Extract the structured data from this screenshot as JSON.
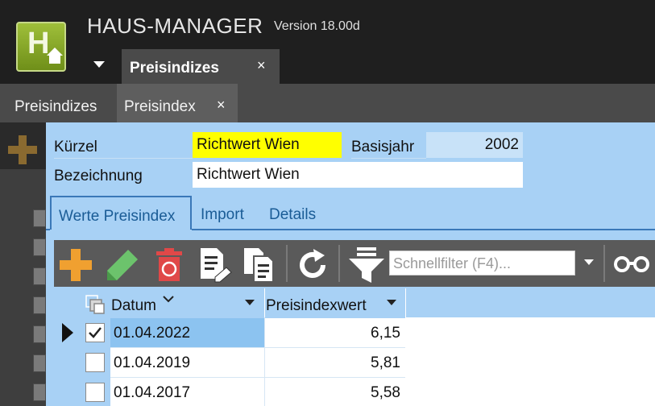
{
  "app": {
    "name": "HAUS-MANAGER",
    "version": "Version 18.00d",
    "logo_letter": "H"
  },
  "top_tabs": [
    {
      "label": "Preisindizes",
      "close": "×"
    }
  ],
  "doc_tabs": [
    {
      "label": "Preisindizes"
    },
    {
      "label": "Preisindex",
      "close": "×",
      "active": true
    }
  ],
  "form": {
    "kuerzel_label": "Kürzel",
    "kuerzel_value": "Richtwert Wien",
    "basisjahr_label": "Basisjahr",
    "basisjahr_value": "2002",
    "bezeichnung_label": "Bezeichnung",
    "bezeichnung_value": "Richtwert Wien"
  },
  "sub_tabs": [
    {
      "label": "Werte Preisindex",
      "active": true
    },
    {
      "label": "Import"
    },
    {
      "label": "Details"
    }
  ],
  "toolbar": {
    "filter_placeholder": "Schnellfilter (F4)..."
  },
  "grid": {
    "columns": [
      {
        "label": "Datum"
      },
      {
        "label": "Preisindexwert"
      }
    ],
    "rows": [
      {
        "datum": "01.04.2022",
        "wert": "6,15",
        "checked": true,
        "selected": true
      },
      {
        "datum": "01.04.2019",
        "wert": "5,81",
        "checked": false,
        "selected": false
      },
      {
        "datum": "01.04.2017",
        "wert": "5,58",
        "checked": false,
        "selected": false
      }
    ]
  },
  "colors": {
    "accent_blue": "#a8d1f5",
    "highlight_yellow": "#ffff00",
    "selected_row": "#8cc3f0",
    "add_orange": "#f0a030",
    "edit_green": "#6cc36c",
    "delete_red": "#e04848"
  }
}
